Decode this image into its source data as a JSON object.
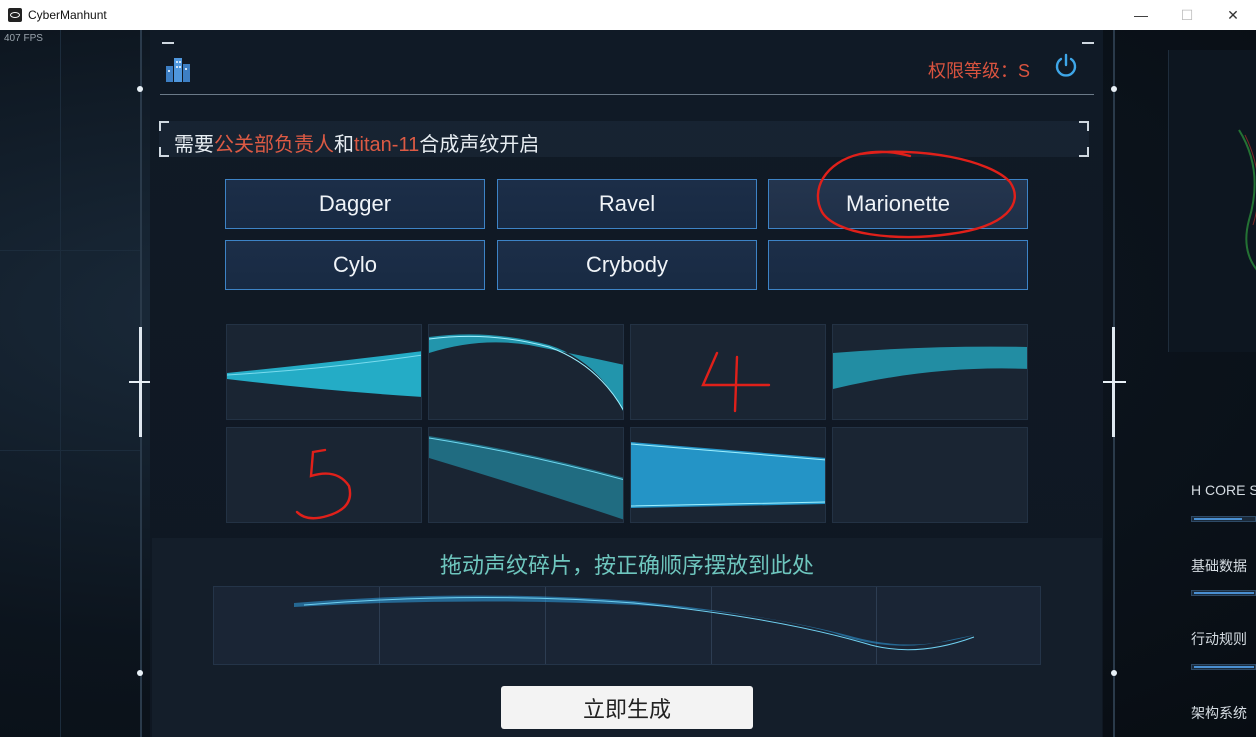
{
  "window": {
    "title": "CyberManhunt",
    "minimize": "—",
    "maximize": "☐",
    "close": "✕"
  },
  "overlay": {
    "fps": "407 FPS"
  },
  "header": {
    "clearance": "权限等级：S"
  },
  "prompt": {
    "prefix": "需要",
    "person1": "公关部负责人",
    "connector": "和",
    "person2": "titan-11",
    "suffix": "合成声纹开启"
  },
  "names": [
    "Dagger",
    "Ravel",
    "Marionette",
    "Cylo",
    "Crybody",
    ""
  ],
  "selected_name": "Marionette",
  "annotations": {
    "tile_3": "4",
    "tile_5": "5"
  },
  "drop": {
    "hint": "拖动声纹碎片，按正确顺序摆放到此处"
  },
  "generate": {
    "label": "立即生成"
  },
  "right_panel": {
    "labels": [
      "H CORE S",
      "基础数据",
      "行动规则",
      "架构系统"
    ],
    "levels": [
      0.75,
      0.95,
      0.95
    ]
  },
  "colors": {
    "accent": "#3d83c6",
    "highlight": "#dc5a44",
    "wave": "#27c4e0",
    "hint": "#6ec6be"
  }
}
